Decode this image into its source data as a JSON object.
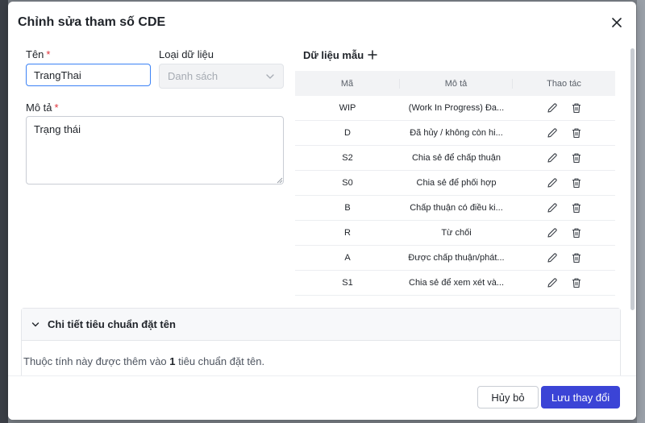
{
  "modal": {
    "title": "Chỉnh sửa tham số CDE"
  },
  "form": {
    "name_label": "Tên",
    "name_value": "TrangThai",
    "type_label": "Loại dữ liệu",
    "type_value": "Danh sách",
    "desc_label": "Mô tả",
    "desc_value": "Trạng thái",
    "required_mark": "*"
  },
  "sample": {
    "title": "Dữ liệu mẫu",
    "columns": [
      "Mã",
      "Mô tả",
      "Thao tác"
    ],
    "rows": [
      {
        "code": "WIP",
        "desc": "(Work In Progress) Đa..."
      },
      {
        "code": "D",
        "desc": "Đã hủy / không còn hi..."
      },
      {
        "code": "S2",
        "desc": "Chia sẻ để chấp thuận"
      },
      {
        "code": "S0",
        "desc": "Chia sẻ để phối hợp"
      },
      {
        "code": "B",
        "desc": "Chấp thuận có điều ki..."
      },
      {
        "code": "R",
        "desc": "Từ chối"
      },
      {
        "code": "A",
        "desc": "Được chấp thuận/phát..."
      },
      {
        "code": "S1",
        "desc": "Chia sẻ để xem xét và..."
      }
    ]
  },
  "naming": {
    "title": "Chi tiết tiêu chuẩn đặt tên",
    "text_before": "Thuộc tính này được thêm vào ",
    "count": "1",
    "text_after": " tiêu chuẩn đặt tên."
  },
  "footer": {
    "cancel_label": "Hủy bỏ",
    "save_label": "Lưu thay đổi"
  },
  "colors": {
    "primary": "#3b44d6",
    "focus": "#3b82f6",
    "required": "#e0323a"
  },
  "icons": [
    "close-icon",
    "plus-icon",
    "chevron-down-icon",
    "edit-icon",
    "trash-icon"
  ]
}
